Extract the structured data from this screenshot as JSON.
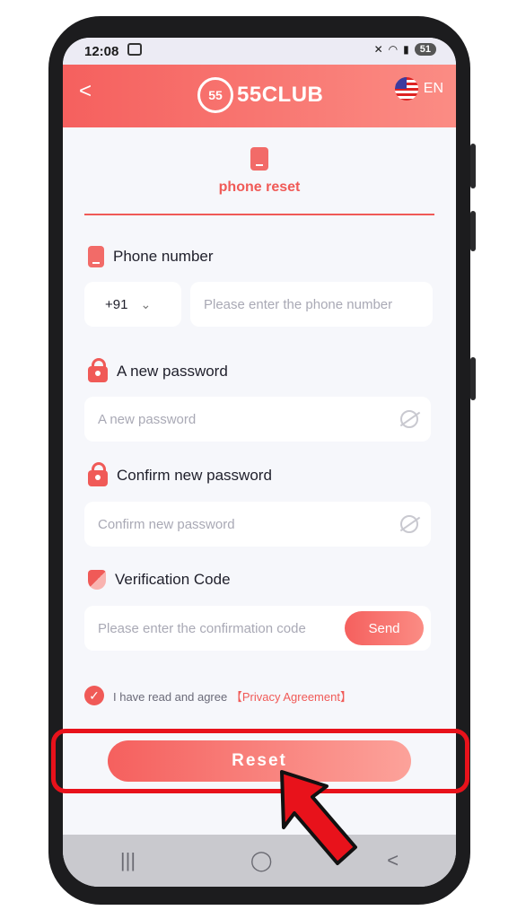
{
  "status": {
    "time": "12:08",
    "battery": "51"
  },
  "header": {
    "back": "<",
    "logo_badge": "55",
    "logo_text": "55CLUB",
    "lang": "EN"
  },
  "tab": {
    "label": "phone reset"
  },
  "phone": {
    "label": "Phone number",
    "code": "+91",
    "placeholder": "Please enter the phone number"
  },
  "password": {
    "label": "A new password",
    "placeholder": "A new password"
  },
  "confirm": {
    "label": "Confirm new password",
    "placeholder": "Confirm new password"
  },
  "verify": {
    "label": "Verification Code",
    "placeholder": "Please enter the confirmation code",
    "send": "Send"
  },
  "agree": {
    "text": "I have read and agree",
    "link": "【Privacy Agreement】"
  },
  "reset": {
    "label": "Reset"
  },
  "nav": {
    "recent": "|||",
    "home": "◯",
    "back": "<"
  }
}
